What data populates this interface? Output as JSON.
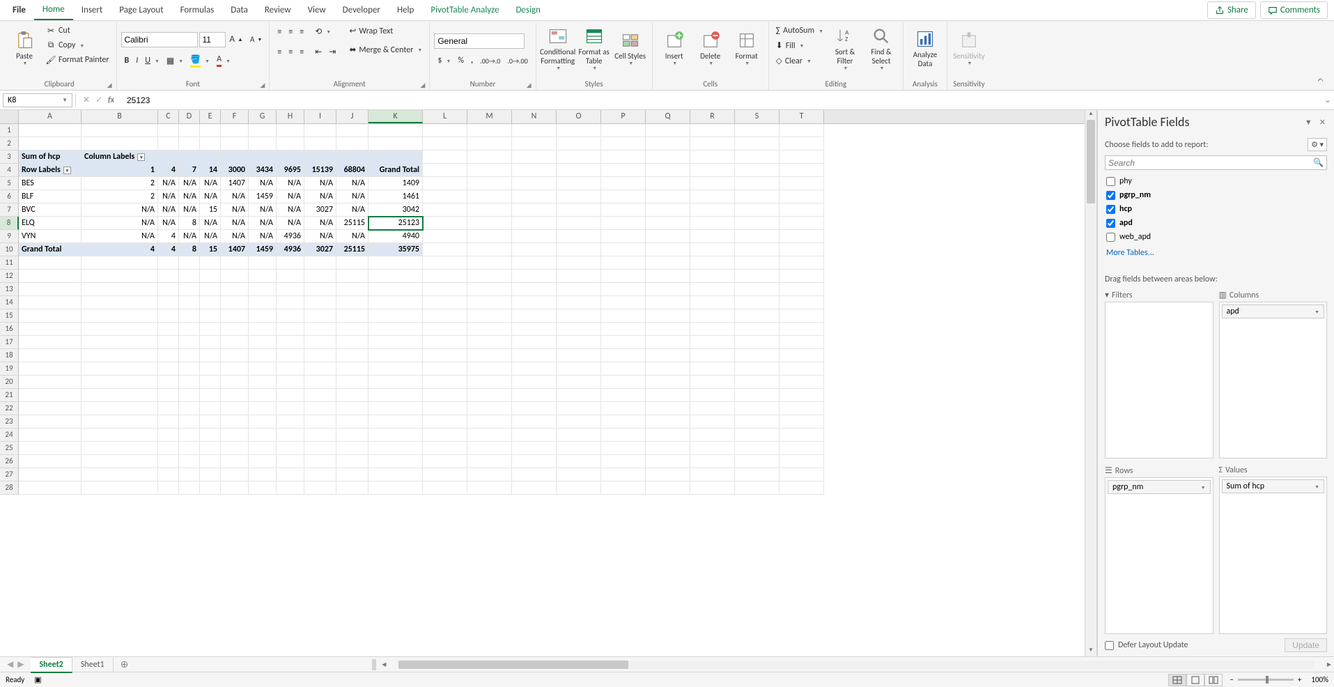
{
  "ribbon_tabs": {
    "file": "File",
    "home": "Home",
    "insert": "Insert",
    "page_layout": "Page Layout",
    "formulas": "Formulas",
    "data": "Data",
    "review": "Review",
    "view": "View",
    "developer": "Developer",
    "help": "Help",
    "analyze": "PivotTable Analyze",
    "design": "Design"
  },
  "share": "Share",
  "comments": "Comments",
  "clipboard": {
    "label": "Clipboard",
    "paste": "Paste",
    "cut": "Cut",
    "copy": "Copy",
    "format_painter": "Format Painter"
  },
  "font": {
    "label": "Font",
    "name": "Calibri",
    "size": "11"
  },
  "alignment": {
    "label": "Alignment",
    "wrap": "Wrap Text",
    "merge": "Merge & Center"
  },
  "number": {
    "label": "Number",
    "format": "General"
  },
  "styles": {
    "label": "Styles",
    "cond": "Conditional Formatting",
    "fat": "Format as Table",
    "cell": "Cell Styles"
  },
  "cells": {
    "label": "Cells",
    "insert": "Insert",
    "delete": "Delete",
    "format": "Format"
  },
  "editing": {
    "label": "Editing",
    "autosum": "AutoSum",
    "fill": "Fill",
    "clear": "Clear",
    "sort": "Sort & Filter",
    "find": "Find & Select"
  },
  "analysis": {
    "label": "Analysis",
    "analyze": "Analyze Data"
  },
  "sensitivity": {
    "label": "Sensitivity",
    "btn": "Sensitivity"
  },
  "name_box": "K8",
  "formula_value": "25123",
  "col_widths": {
    "A": 90,
    "B": 110,
    "C": 30,
    "D": 30,
    "E": 30,
    "F": 40,
    "G": 40,
    "H": 40,
    "I": 46,
    "J": 46,
    "K": 78,
    "L": 64,
    "M": 64,
    "N": 64,
    "O": 64,
    "P": 64,
    "Q": 64,
    "R": 64,
    "S": 64,
    "T": 64
  },
  "columns": [
    "A",
    "B",
    "C",
    "D",
    "E",
    "F",
    "G",
    "H",
    "I",
    "J",
    "K",
    "L",
    "M",
    "N",
    "O",
    "P",
    "Q",
    "R",
    "S",
    "T"
  ],
  "active_col": "K",
  "active_row": 8,
  "pivot": {
    "sum_label": "Sum of hcp",
    "col_labels": "Column Labels",
    "row_labels": "Row Labels",
    "col_vals": [
      "1",
      "4",
      "7",
      "14",
      "3000",
      "3434",
      "9695",
      "15139",
      "68804"
    ],
    "grand_total": "Grand Total",
    "rows": [
      {
        "label": "BES",
        "vals": [
          "2",
          "N/A",
          "N/A",
          "N/A",
          "1407",
          "N/A",
          "N/A",
          "N/A",
          "N/A"
        ],
        "total": "1409"
      },
      {
        "label": "BLF",
        "vals": [
          "2",
          "N/A",
          "N/A",
          "N/A",
          "N/A",
          "1459",
          "N/A",
          "N/A",
          "N/A"
        ],
        "total": "1461"
      },
      {
        "label": "BVC",
        "vals": [
          "N/A",
          "N/A",
          "N/A",
          "15",
          "N/A",
          "N/A",
          "N/A",
          "3027",
          "N/A"
        ],
        "total": "3042"
      },
      {
        "label": "ELQ",
        "vals": [
          "N/A",
          "N/A",
          "8",
          "N/A",
          "N/A",
          "N/A",
          "N/A",
          "N/A",
          "25115"
        ],
        "total": "25123"
      },
      {
        "label": "VYN",
        "vals": [
          "N/A",
          "4",
          "N/A",
          "N/A",
          "N/A",
          "N/A",
          "4936",
          "N/A",
          "N/A"
        ],
        "total": "4940"
      }
    ],
    "totals": {
      "label": "Grand Total",
      "vals": [
        "4",
        "4",
        "8",
        "15",
        "1407",
        "1459",
        "4936",
        "3027",
        "25115"
      ],
      "total": "35975"
    }
  },
  "sheet_tabs": {
    "active": "Sheet2",
    "other": "Sheet1"
  },
  "status": {
    "ready": "Ready",
    "zoom": "100%"
  },
  "fields_pane": {
    "title": "PivotTable Fields",
    "choose": "Choose fields to add to report:",
    "search": "Search",
    "fields": [
      {
        "name": "phy",
        "checked": false
      },
      {
        "name": "pgrp_nm",
        "checked": true
      },
      {
        "name": "hcp",
        "checked": true
      },
      {
        "name": "apd",
        "checked": true
      },
      {
        "name": "web_apd",
        "checked": false
      }
    ],
    "more": "More Tables...",
    "drag": "Drag fields between areas below:",
    "filters": "Filters",
    "columns": "Columns",
    "rows": "Rows",
    "values": "Values",
    "col_chip": "apd",
    "row_chip": "pgrp_nm",
    "val_chip": "Sum of hcp",
    "defer": "Defer Layout Update",
    "update": "Update"
  }
}
